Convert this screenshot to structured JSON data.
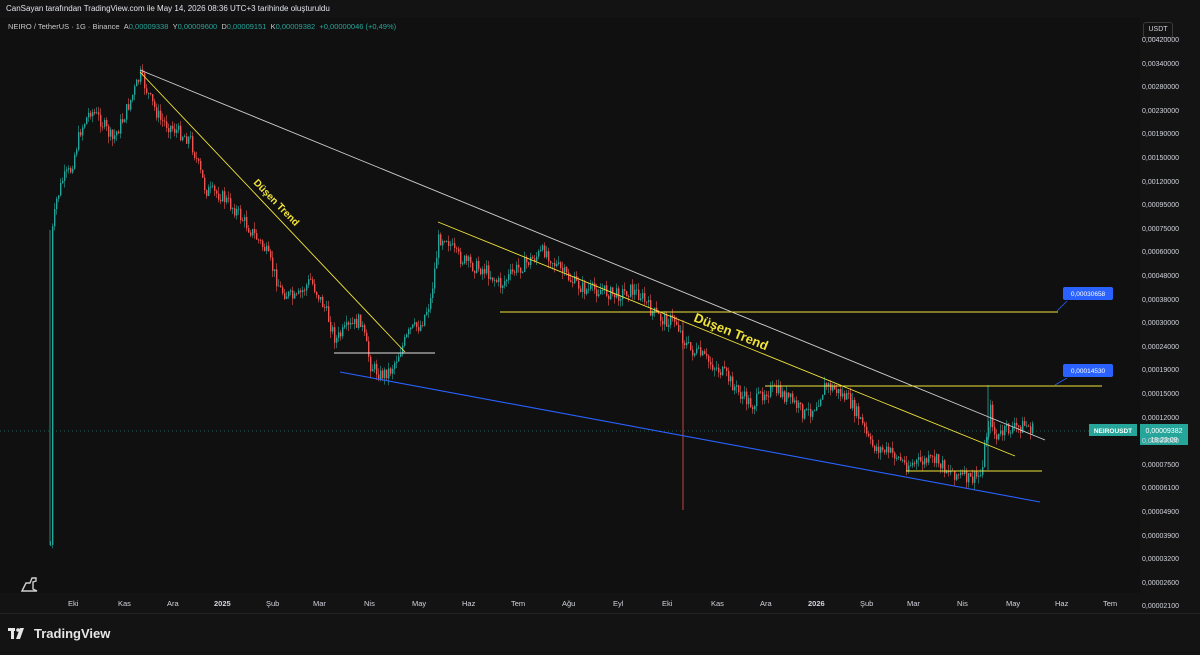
{
  "header": {
    "title": "CanSayan tarafından TradingView.com ile May 14, 2026 08:36 UTC+3 tarihinde oluşturuldu"
  },
  "legend": {
    "symbol": "NEIRO / TetherUS · 1G · Binance",
    "open_key": "A",
    "open": "0,00009338",
    "high_key": "Y",
    "high": "0,00009600",
    "low_key": "D",
    "low": "0,00009151",
    "close_key": "K",
    "close": "0,00009382",
    "change": "+0,00000046 (+0,49%)"
  },
  "currency": "USDT",
  "price_axis": [
    "0,00420000",
    "0,00340000",
    "0,00280000",
    "0,00230000",
    "0,00190000",
    "0,00150000",
    "0,00120000",
    "0,00095000",
    "0,00075000",
    "0,00060000",
    "0,00048000",
    "0,00038000",
    "0,00030000",
    "0,00024000",
    "0,00019000",
    "0,00015000",
    "0,00012000",
    "0,00009500",
    "0,00007500",
    "0,00006100",
    "0,00004900",
    "0,00003900",
    "0,00003200",
    "0,00002600",
    "0,00002100"
  ],
  "time_axis": [
    {
      "label": "Eki",
      "bold": false
    },
    {
      "label": "Kas",
      "bold": false
    },
    {
      "label": "Ara",
      "bold": false
    },
    {
      "label": "2025",
      "bold": true
    },
    {
      "label": "Şub",
      "bold": false
    },
    {
      "label": "Mar",
      "bold": false
    },
    {
      "label": "Nis",
      "bold": false
    },
    {
      "label": "May",
      "bold": false
    },
    {
      "label": "Haz",
      "bold": false
    },
    {
      "label": "Tem",
      "bold": false
    },
    {
      "label": "Ağu",
      "bold": false
    },
    {
      "label": "Eyl",
      "bold": false
    },
    {
      "label": "Eki",
      "bold": false
    },
    {
      "label": "Kas",
      "bold": false
    },
    {
      "label": "Ara",
      "bold": false
    },
    {
      "label": "2026",
      "bold": true
    },
    {
      "label": "Şub",
      "bold": false
    },
    {
      "label": "Mar",
      "bold": false
    },
    {
      "label": "Nis",
      "bold": false
    },
    {
      "label": "May",
      "bold": false
    },
    {
      "label": "Haz",
      "bold": false
    },
    {
      "label": "Tem",
      "bold": false
    }
  ],
  "annotations": {
    "trend1": "Düşen Trend",
    "trend2": "Düşen Trend",
    "callout_high": "0,00030658",
    "callout_mid": "0,00014530"
  },
  "last_price": {
    "symbol": "NEIROUSDT",
    "price": "0,00009382",
    "countdown": "18:23:09"
  },
  "colors": {
    "up": "#26a69a",
    "down": "#ef5350",
    "yellow": "#f0e33a",
    "blue_line": "#2962ff",
    "white_line": "#cfcfcf",
    "callout": "#2962ff"
  },
  "brand": "TradingView"
}
